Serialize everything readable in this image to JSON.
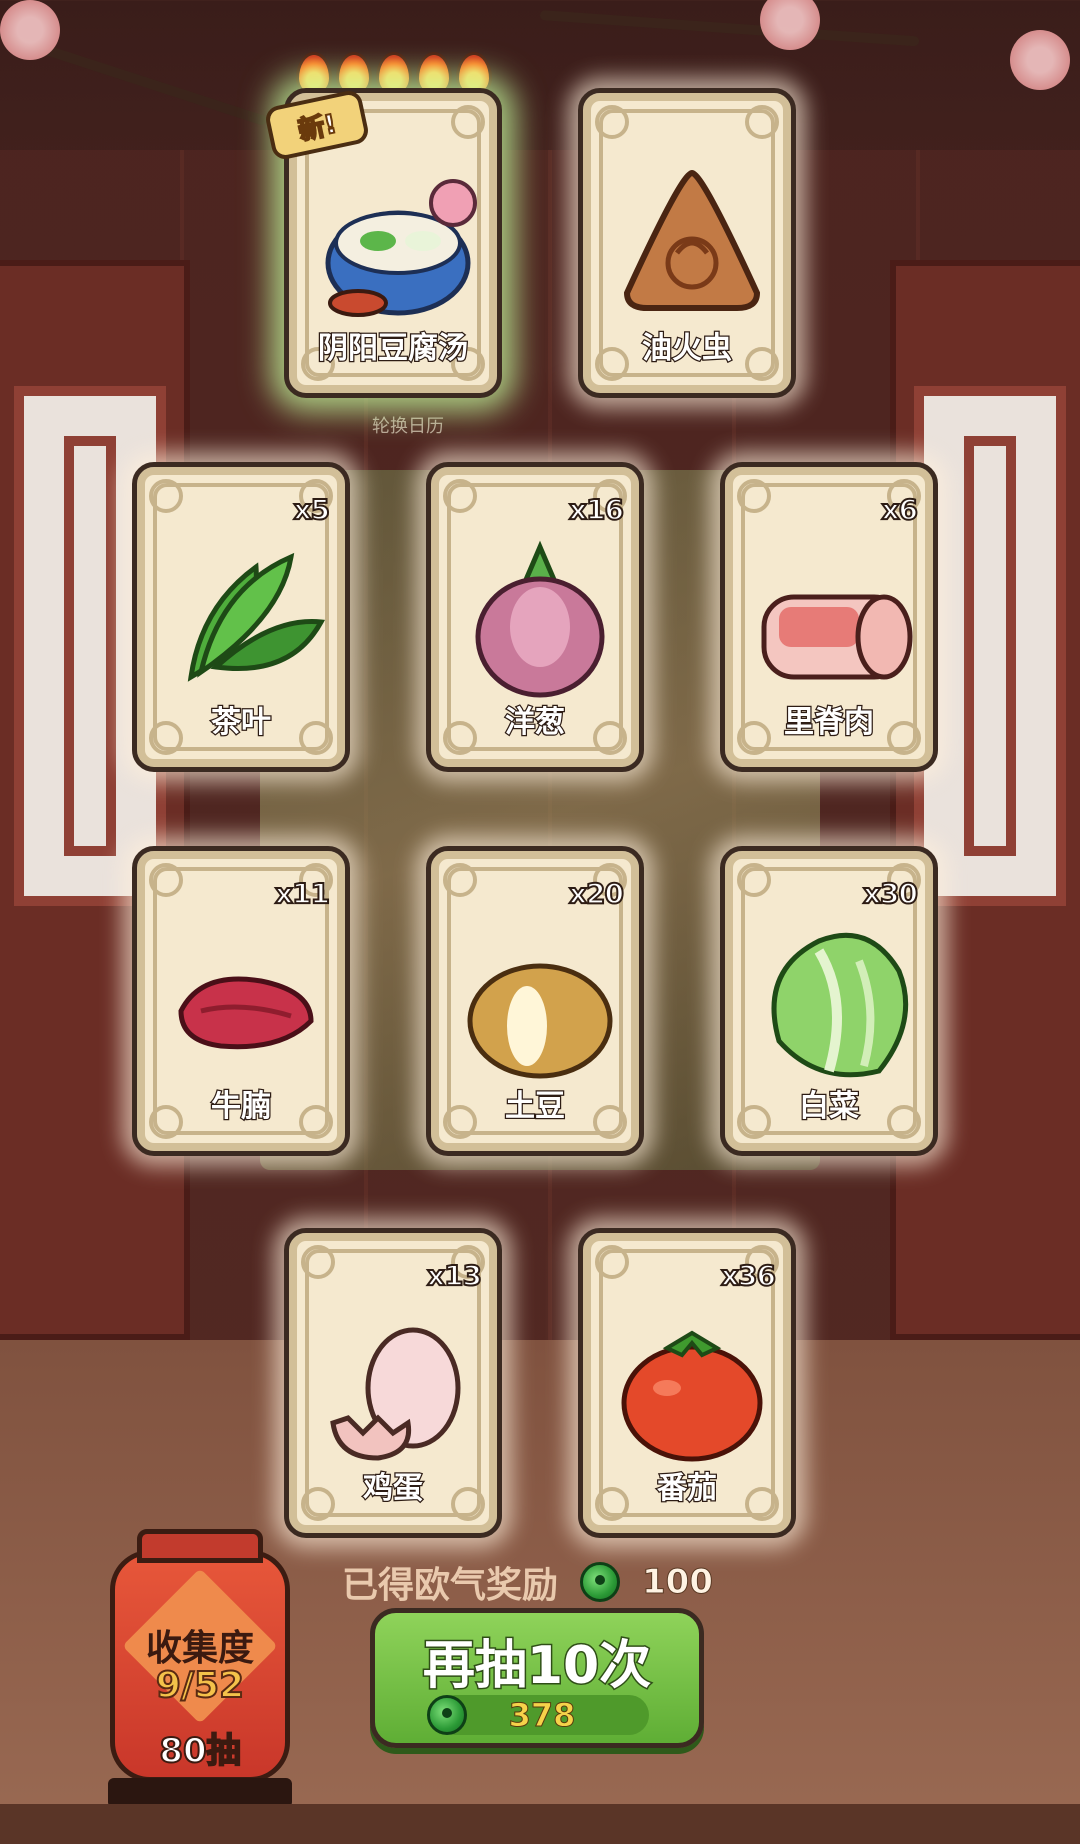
{
  "header": {
    "rotate_label": "轮换日历",
    "new_badge": "新!"
  },
  "cards": [
    {
      "name": "阴阳豆腐汤",
      "count": "",
      "icon": "tofu-soup-icon",
      "special": true
    },
    {
      "name": "油火虫",
      "count": "",
      "icon": "firefly-triangle-icon"
    },
    {
      "name": "茶叶",
      "count": "x5",
      "icon": "tea-leaf-icon"
    },
    {
      "name": "洋葱",
      "count": "x16",
      "icon": "onion-icon"
    },
    {
      "name": "里脊肉",
      "count": "x6",
      "icon": "tenderloin-icon"
    },
    {
      "name": "牛腩",
      "count": "x11",
      "icon": "beef-brisket-icon"
    },
    {
      "name": "土豆",
      "count": "x20",
      "icon": "potato-icon"
    },
    {
      "name": "白菜",
      "count": "x30",
      "icon": "cabbage-icon"
    },
    {
      "name": "鸡蛋",
      "count": "x13",
      "icon": "egg-icon"
    },
    {
      "name": "番茄",
      "count": "x36",
      "icon": "tomato-icon"
    }
  ],
  "flames": 5,
  "reward": {
    "label": "已得欧气奖励",
    "amount": "100"
  },
  "draw_button": {
    "label": "再抽10次",
    "cost": "378"
  },
  "collection": {
    "title": "收集度",
    "progress": "9/52",
    "draws": "80抽"
  },
  "colors": {
    "accent_green": "#5fae35",
    "lantern_red": "#c9372a",
    "card_bg": "#f5e9cf"
  }
}
